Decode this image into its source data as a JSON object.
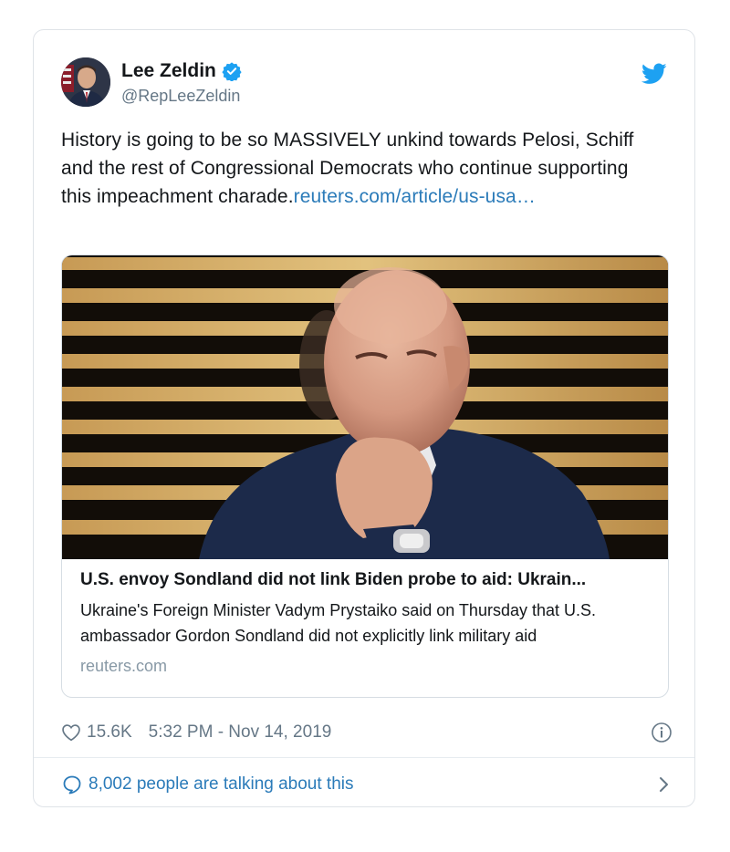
{
  "tweet": {
    "author": {
      "display_name": "Lee Zeldin",
      "handle": "@RepLeeZeldin",
      "verified": true
    },
    "text": "History is going to be so MASSIVELY unkind towards Pelosi, Schiff and the rest of Congressional Democrats who continue supporting this impeachment charade.",
    "link_text": "reuters.com/article/us-usa…",
    "card": {
      "title": "U.S. envoy Sondland did not link Biden probe to aid: Ukrain...",
      "description": "Ukraine's Foreign Minister Vadym Prystaiko said on Thursday that U.S. ambassador Gordon Sondland did not explicitly link military aid",
      "domain": "reuters.com"
    },
    "like_count": "15.6K",
    "timestamp": "5:32 PM - Nov 14, 2019",
    "talking_text": "8,002 people are talking about this"
  },
  "icons": {
    "verified": "verified-badge-icon",
    "platform": "twitter-bird-icon",
    "like": "heart-icon",
    "info": "info-icon",
    "reply": "speech-bubble-icon",
    "chevron": "chevron-right-icon"
  },
  "colors": {
    "link": "#2b7bb9",
    "twitter_blue": "#1da1f2",
    "secondary_text": "#657786",
    "border": "#dfe3e8"
  }
}
